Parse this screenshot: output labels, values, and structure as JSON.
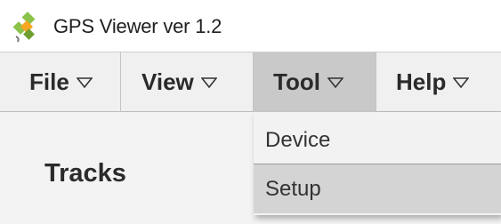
{
  "window": {
    "title": "GPS Viewer ver 1.2",
    "app_icon": "gps-satellite-icon"
  },
  "menubar": {
    "items": [
      {
        "label": "File",
        "icon": "chevron-down-icon"
      },
      {
        "label": "View",
        "icon": "chevron-down-icon"
      },
      {
        "label": "Tool",
        "icon": "chevron-down-icon",
        "active": true
      },
      {
        "label": "Help",
        "icon": "chevron-down-icon"
      }
    ]
  },
  "tool_menu": {
    "items": [
      {
        "label": "Device"
      },
      {
        "label": "Setup",
        "highlighted": true
      }
    ]
  },
  "main": {
    "heading": "Tracks"
  },
  "colors": {
    "menubar_bg": "#f0f0f0",
    "menu_active_bg": "#c9c9c9",
    "dropdown_bg": "#f2f2f2",
    "dropdown_highlight_bg": "#d4d4d4"
  }
}
